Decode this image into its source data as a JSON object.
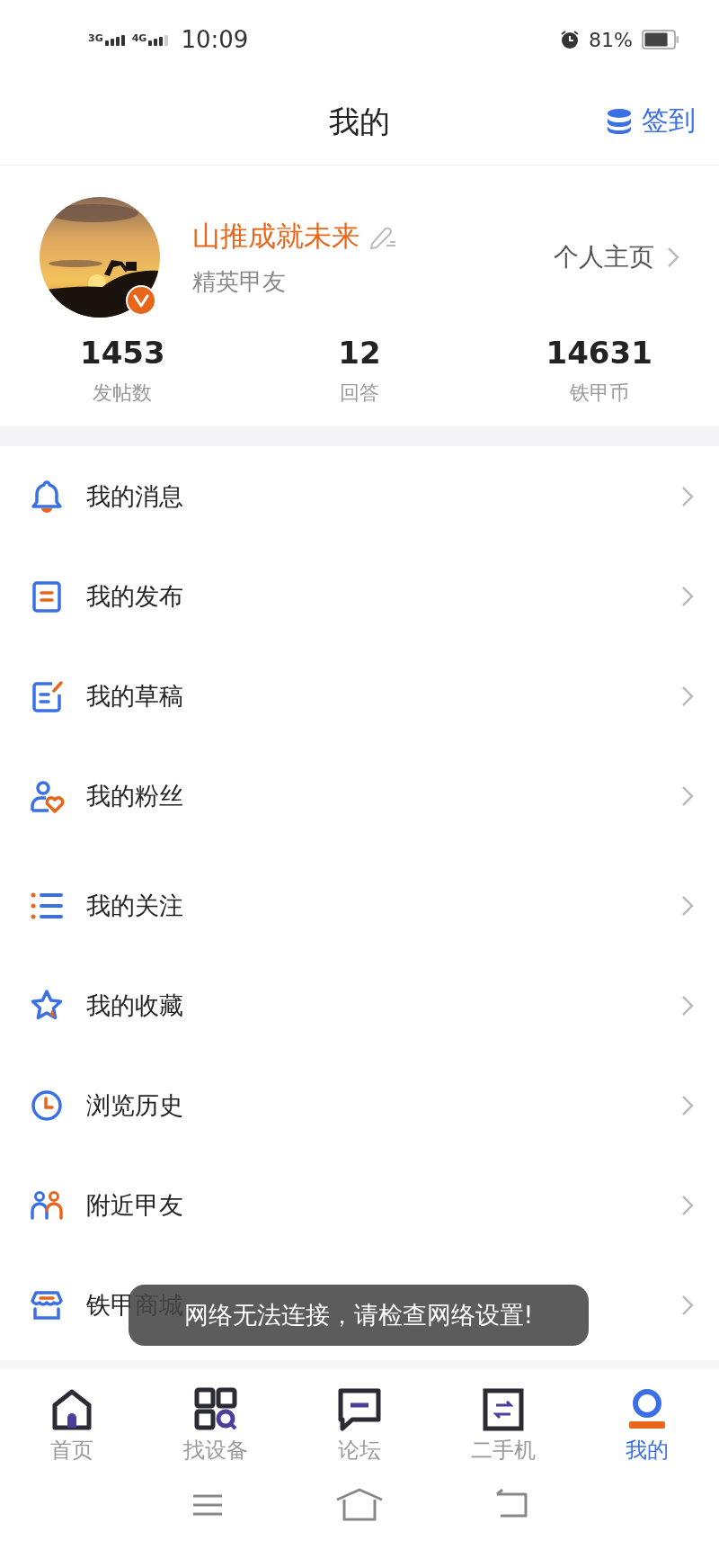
{
  "status_bar": {
    "networks": [
      "3G",
      "4G"
    ],
    "time": "10:09",
    "battery": "81%"
  },
  "header": {
    "title": "我的",
    "checkin": "签到"
  },
  "profile": {
    "name": "山推成就未来",
    "level": "精英甲友",
    "homepage": "个人主页"
  },
  "stats": [
    {
      "value": "1453",
      "label": "发帖数"
    },
    {
      "value": "12",
      "label": "回答"
    },
    {
      "value": "14631",
      "label": "铁甲币"
    }
  ],
  "menu": [
    {
      "label": "我的消息"
    },
    {
      "label": "我的发布"
    },
    {
      "label": "我的草稿"
    },
    {
      "label": "我的粉丝"
    },
    {
      "label": "我的关注"
    },
    {
      "label": "我的收藏"
    },
    {
      "label": "浏览历史"
    },
    {
      "label": "附近甲友"
    },
    {
      "label": "铁甲商城"
    }
  ],
  "toast": "网络无法连接，请检查网络设置!",
  "tab_bar": [
    {
      "label": "首页",
      "selected": false
    },
    {
      "label": "找设备",
      "selected": false
    },
    {
      "label": "论坛",
      "selected": false
    },
    {
      "label": "二手机",
      "selected": false
    },
    {
      "label": "我的",
      "selected": true
    }
  ]
}
